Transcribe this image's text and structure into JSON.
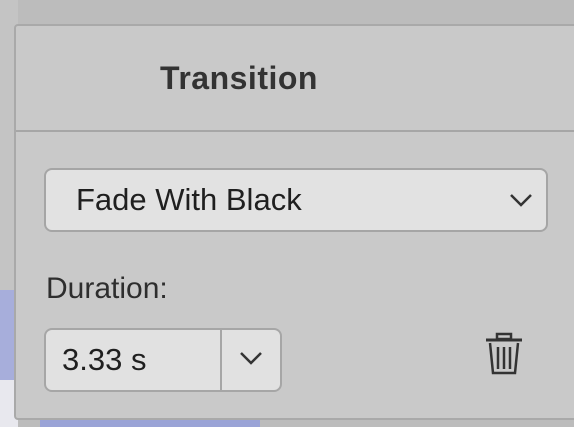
{
  "panel": {
    "title": "Transition"
  },
  "transition_select": {
    "value": "Fade With Black",
    "icon": "chevron-down-icon"
  },
  "duration": {
    "label": "Duration:",
    "value": "3.33 s",
    "icon": "chevron-down-icon"
  },
  "delete": {
    "icon": "trash-icon"
  },
  "colors": {
    "panel_bg": "#c9c9c9",
    "control_bg": "#e2e2e2",
    "border": "#a6a6a6",
    "text": "#1f1f1f"
  }
}
